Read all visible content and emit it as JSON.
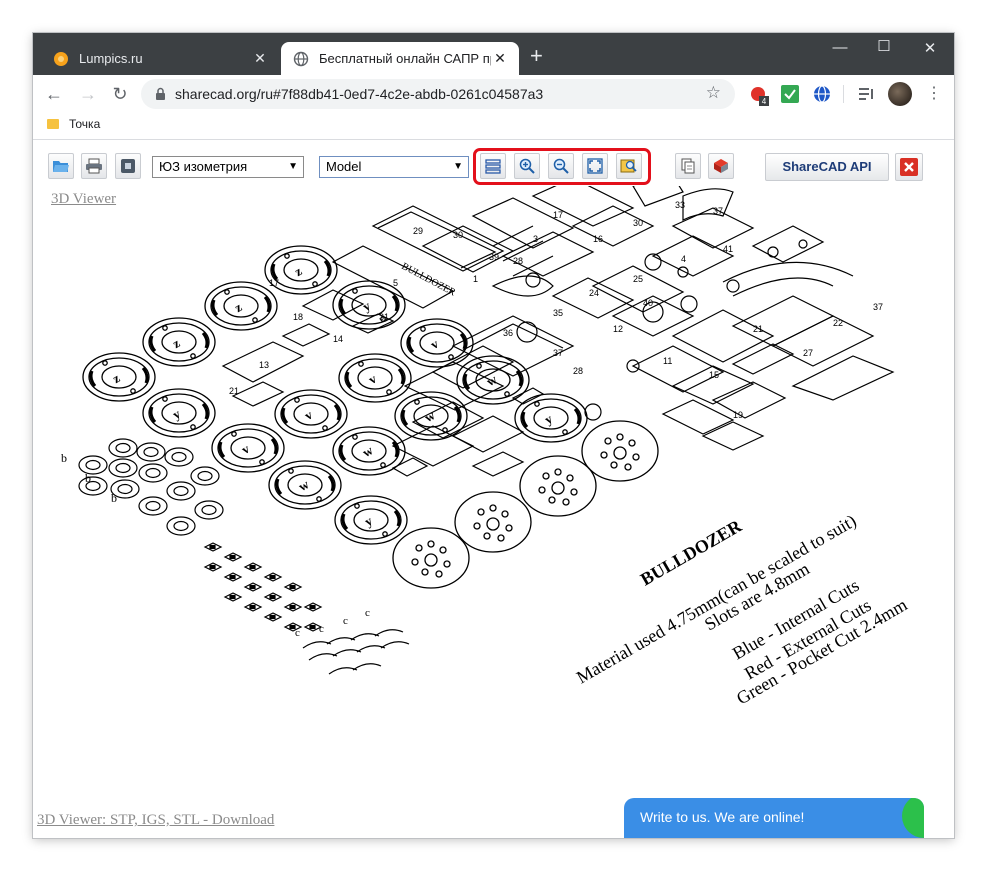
{
  "browser": {
    "tabs": [
      {
        "title": "Lumpics.ru",
        "favicon": "orange-circle-icon",
        "active": false
      },
      {
        "title": "Бесплатный онлайн САПР прос",
        "favicon": "globe-icon",
        "active": true
      }
    ],
    "url": "sharecad.org/ru#7f88db41-0ed7-4c2e-abdb-0261c04587a3",
    "bookmarks": [
      {
        "label": "Точка"
      }
    ],
    "extension_badge": "4"
  },
  "cad_toolbar": {
    "view_select": {
      "value": "ЮЗ изометрия"
    },
    "layout_select": {
      "value": "Model"
    },
    "api_button": "ShareCAD API",
    "highlight_color": "#e3101b"
  },
  "drawing": {
    "caption": {
      "title": "BULLDOZER",
      "line1": "Material used 4.75mm(can be scaled to suit)",
      "line2": "Slots are 4.8mm",
      "line3": "Blue - Internal Cuts",
      "line4": "Red - External Cuts",
      "line5": "Green - Pocket Cut 2.4mm"
    },
    "part_label": "BULLDOZER"
  },
  "links": {
    "viewer3d": "3D Viewer",
    "download": "3D Viewer: STP, IGS, STL - Download"
  },
  "chat": {
    "text": "Write to us. We are online!"
  }
}
